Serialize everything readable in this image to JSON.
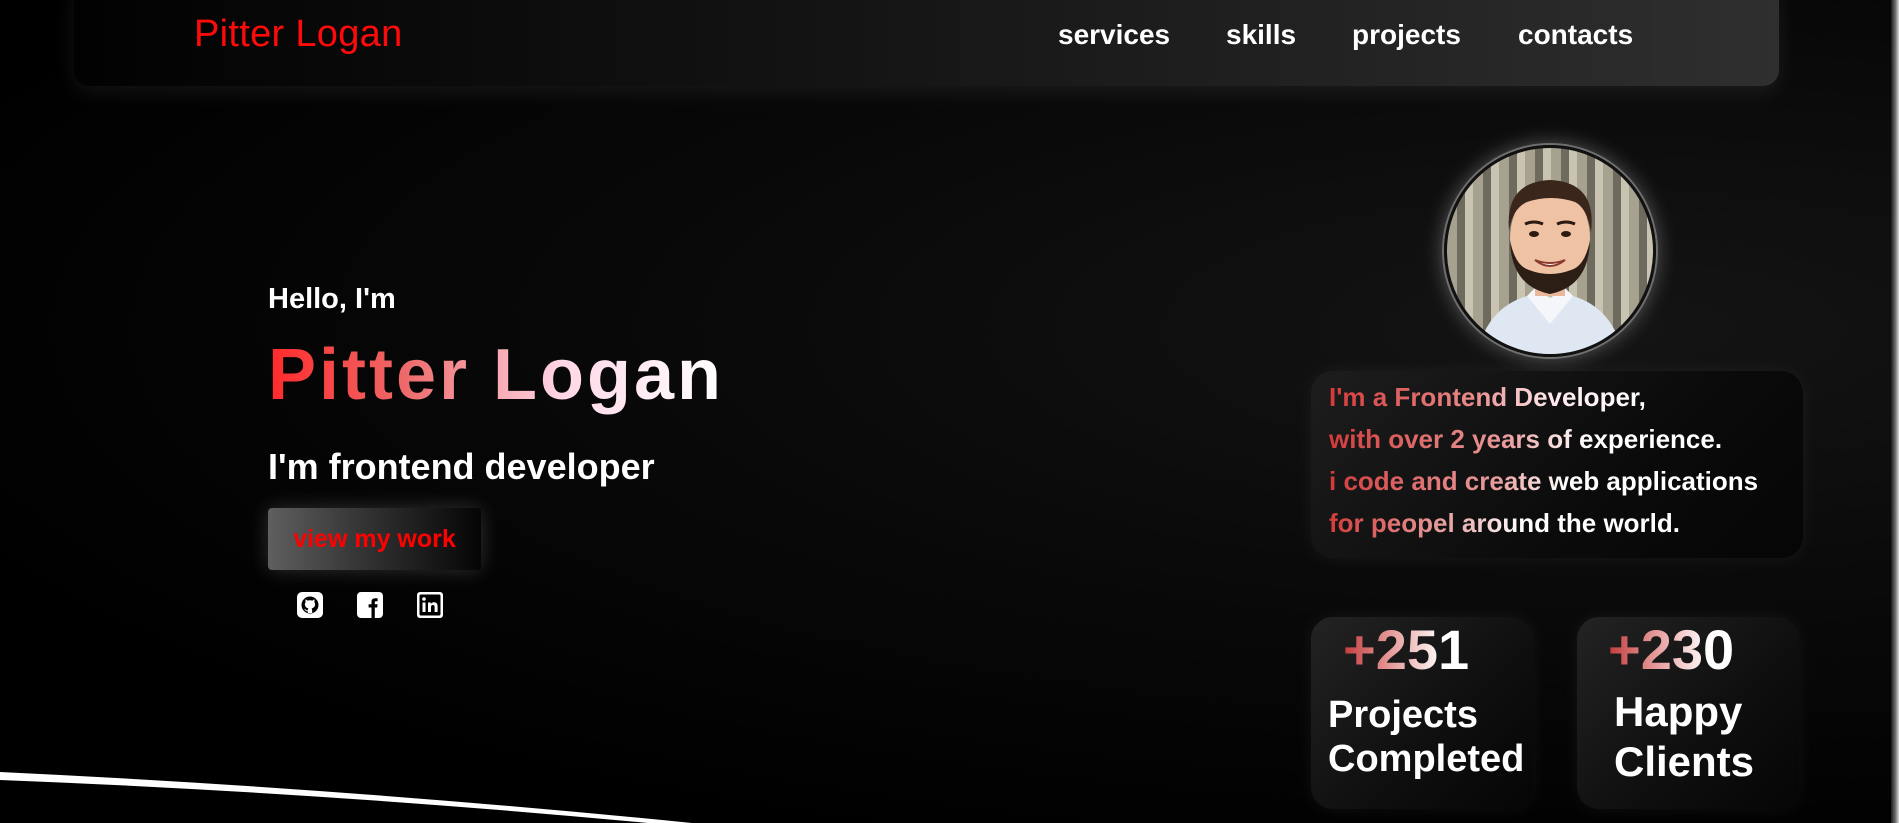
{
  "navbar": {
    "brand": "Pitter Logan",
    "links": [
      "services",
      "skills",
      "projects",
      "contacts"
    ]
  },
  "hero": {
    "greeting": "Hello, I'm",
    "name": "Pitter Logan",
    "role": "I'm frontend developer",
    "cta_label": "view my work",
    "socials": [
      "github-icon",
      "facebook-icon",
      "linkedin-icon"
    ]
  },
  "about": {
    "lines": [
      "I'm a Frontend Developer,",
      "with over 2 years of experience.",
      "i code and create web applications",
      "for peopel around the world."
    ]
  },
  "stats": [
    {
      "number": "+251",
      "label_line1": "Projects",
      "label_line2": "Completed"
    },
    {
      "number": "+230",
      "label_line1": "Happy",
      "label_line2": "Clients"
    }
  ],
  "colors": {
    "accent": "#ff0a0a",
    "background": "#000000",
    "text": "#ffffff"
  }
}
